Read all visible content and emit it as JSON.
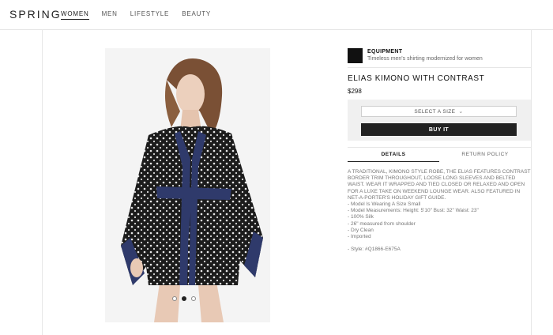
{
  "header": {
    "logo": "SPRING",
    "nav": [
      {
        "label": "WOMEN",
        "active": true
      },
      {
        "label": "MEN",
        "active": false
      },
      {
        "label": "LIFESTYLE",
        "active": false
      },
      {
        "label": "BEAUTY",
        "active": false
      }
    ]
  },
  "product": {
    "brand_name": "EQUIPMENT",
    "brand_tagline": "Timeless men's shirting modernized for women",
    "title": "ELIAS KIMONO WITH CONTRAST",
    "price": "$298",
    "size_select_label": "SELECT A SIZE",
    "buy_label": "BUY IT",
    "carousel": {
      "count": 3,
      "active_index": 1
    }
  },
  "tabs": [
    {
      "label": "DETAILS",
      "active": true
    },
    {
      "label": "RETURN POLICY",
      "active": false
    }
  ],
  "details": {
    "description": "A TRADITIONAL, KIMONO STYLE ROBE, THE ELIAS FEATURES CONTRAST BORDER TRIM THROUGHOUT, LOOSE LONG SLEEVES AND BELTED WAIST. WEAR IT WRAPPED AND TIED CLOSED OR RELAXED AND OPEN FOR A LUXE TAKE ON WEEKEND LOUNGE WEAR. ALSO FEATURED IN NET-A-PORTER'S HOLIDAY GIFT GUIDE.",
    "bullets": [
      "-  Model Is Wearing A Size Small",
      "-  Model Measurements: Height: 5'10\" Bust: 32\" Waist: 23\"",
      "-  100% Silk",
      "- 26\" measured from shoulder",
      "-  Dry Clean",
      "-  Imported"
    ],
    "style": "- Style: #Q1866-E675A"
  },
  "colors": {
    "accent": "#222222",
    "kimono_trim": "#2f3a6b",
    "kimono_print": "#1c1c1c"
  }
}
